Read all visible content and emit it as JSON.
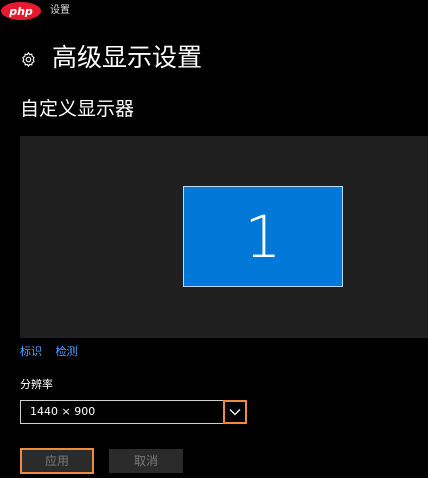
{
  "titlebar": {
    "logo_text": "php",
    "app_title": "设置"
  },
  "page": {
    "title": "高级显示设置",
    "header_icon": "gear-icon"
  },
  "arrangement": {
    "section_title": "自定义显示器",
    "monitors": [
      {
        "number": "1"
      }
    ]
  },
  "links": {
    "identify": "标识",
    "detect": "检测"
  },
  "resolution": {
    "label": "分辨率",
    "value": "1440 × 900",
    "dropdown_icon": "chevron-down-icon"
  },
  "buttons": {
    "apply": "应用",
    "cancel": "取消"
  },
  "colors": {
    "accent": "#0078d7",
    "link": "#4aa3ff",
    "highlight": "#f08a3c",
    "logo": "#e8192c"
  }
}
